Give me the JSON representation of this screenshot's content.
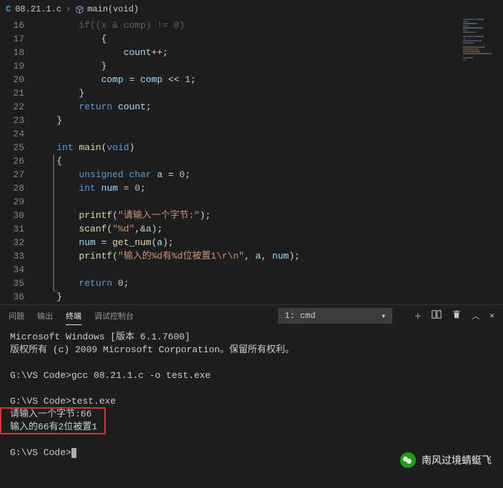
{
  "breadcrumb": {
    "file_icon": "C",
    "filename": "08.21.1.c",
    "sep": "›",
    "func_icon": "⬢",
    "func": "main(void)"
  },
  "gutter": {
    "start": 16,
    "lines": [
      "16",
      "17",
      "18",
      "19",
      "20",
      "21",
      "22",
      "23",
      "24",
      "25",
      "26",
      "27",
      "28",
      "29",
      "30",
      "31",
      "32",
      "33",
      "34",
      "35",
      "36"
    ]
  },
  "code": {
    "l16": {
      "raw": "        if((x & comp) != 0)"
    },
    "l17": {
      "brace": "{"
    },
    "l18": {
      "var": "count",
      "op": "++;"
    },
    "l19": {
      "brace": "}"
    },
    "l20": {
      "v1": "comp",
      "eq": " = ",
      "v2": "comp",
      "sh": " << ",
      "n": "1",
      "sc": ";"
    },
    "l21": {
      "brace": "}"
    },
    "l22": {
      "kw": "return",
      "sp": " ",
      "var": "count",
      "sc": ";"
    },
    "l23": {
      "brace": "}"
    },
    "l25": {
      "t1": "int",
      "sp": " ",
      "fn": "main",
      "p": "(",
      "t2": "void",
      "rp": ")"
    },
    "l26": {
      "brace": "{"
    },
    "l27": {
      "t1": "unsigned",
      "t2": "char",
      "var": "a",
      "eq": " = ",
      "n": "0",
      "sc": ";"
    },
    "l28": {
      "t1": "int",
      "var": "num",
      "eq": " = ",
      "n": "0",
      "sc": ";"
    },
    "l30": {
      "fn": "printf",
      "p": "(",
      "s": "\"请输入一个字节:\"",
      "rp": ");"
    },
    "l31": {
      "fn": "scanf",
      "p": "(",
      "s": "\"%d\"",
      "c": ",",
      "amp": "&",
      "var": "a",
      "rp": ");"
    },
    "l32": {
      "v1": "num",
      "eq": " = ",
      "fn": "get_num",
      "p": "(",
      "v2": "a",
      "rp": ");"
    },
    "l33": {
      "fn": "printf",
      "p": "(",
      "s": "\"输入的%d有%d位被置1\\r\\n\"",
      "c": ", ",
      "v1": "a",
      "c2": ", ",
      "v2": "num",
      "rp": ");"
    },
    "l35": {
      "kw": "return",
      "sp": " ",
      "n": "0",
      "sc": ";"
    },
    "l36": {
      "brace": "}"
    }
  },
  "panel": {
    "tabs": {
      "problems": "问题",
      "output": "输出",
      "terminal": "终端",
      "debug": "调试控制台"
    },
    "select": "1: cmd"
  },
  "terminal": {
    "l1": "Microsoft Windows [版本 6.1.7600]",
    "l2": "版权所有 (c) 2009 Microsoft Corporation。保留所有权利。",
    "l3": "",
    "l4": "G:\\VS Code>gcc 08.21.1.c -o test.exe",
    "l5": "",
    "l6": "G:\\VS Code>test.exe",
    "l7": "请输入一个字节:66",
    "l8": "输入的66有2位被置1",
    "l9": "",
    "l10": "G:\\VS Code>"
  },
  "watermark": {
    "text": "南风过境蜻蜓飞"
  }
}
